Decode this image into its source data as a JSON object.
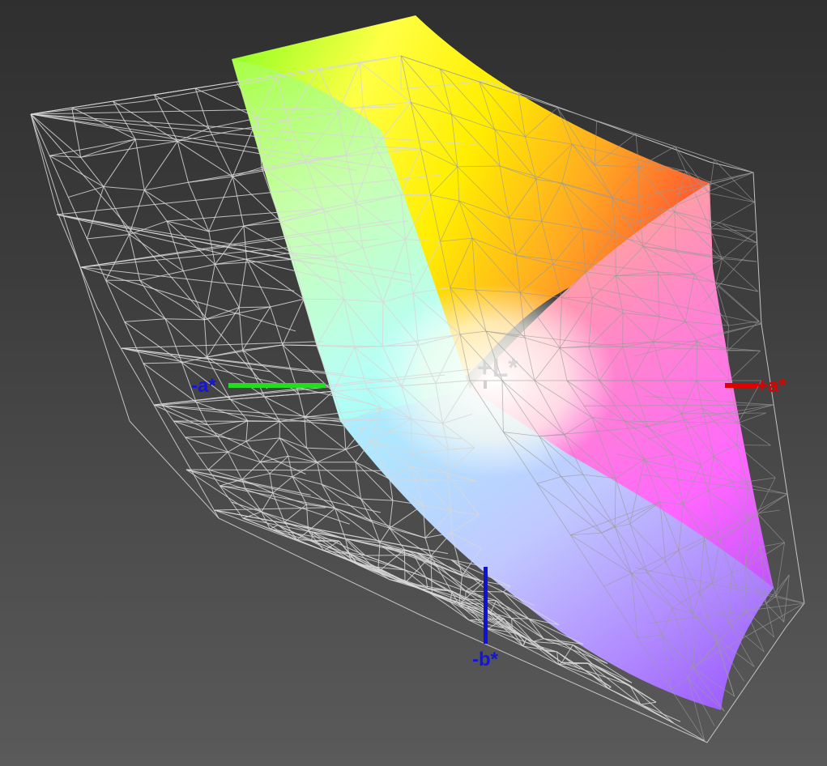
{
  "axes": {
    "plus_l": "+L*",
    "plus_a": "+a*",
    "minus_a": "-a*",
    "minus_b": "-b*"
  },
  "colors": {
    "background_top": "#2f2f2f",
    "background_bottom": "#5a5a5a",
    "wireframe": "#d8d8d8",
    "axis_plus_a": "#e00000",
    "axis_minus_a": "#22dd22",
    "axis_minus_b": "#1010dd",
    "axis_plus_l": "#d0d0d0"
  }
}
